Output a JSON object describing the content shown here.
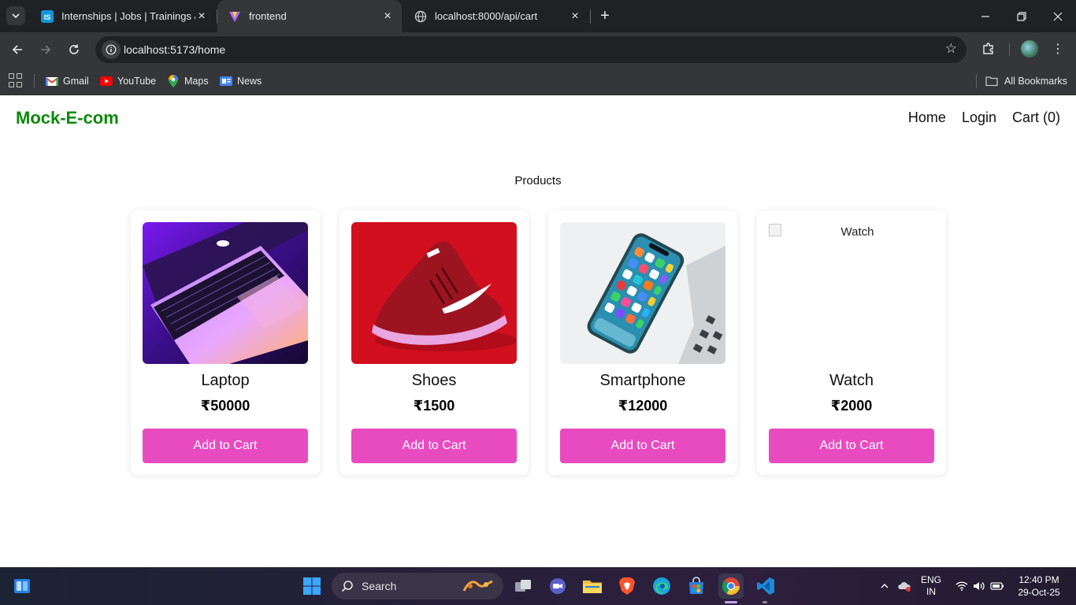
{
  "browser": {
    "tabs": [
      {
        "title": "Internships | Jobs | Trainings & I",
        "favicon": "internshala-icon",
        "active": false
      },
      {
        "title": "frontend",
        "favicon": "vite-icon",
        "active": true
      },
      {
        "title": "localhost:8000/api/cart",
        "favicon": "globe-icon",
        "active": false
      }
    ],
    "url": "localhost:5173/home",
    "bookmarks": [
      {
        "label": "Gmail",
        "icon": "gmail-icon"
      },
      {
        "label": "YouTube",
        "icon": "youtube-icon"
      },
      {
        "label": "Maps",
        "icon": "maps-icon"
      },
      {
        "label": "News",
        "icon": "news-icon"
      }
    ],
    "all_bookmarks": "All Bookmarks",
    "tab_search_badge": "IS"
  },
  "site": {
    "brand": "Mock-E-com",
    "brand_color": "#0a8a0a",
    "nav": {
      "home": "Home",
      "login": "Login",
      "cart": "Cart (0)"
    },
    "heading": "Products",
    "button_color": "#e84bc0",
    "products": [
      {
        "name": "Laptop",
        "price": "₹50000",
        "button": "Add to Cart",
        "image": "laptop-image"
      },
      {
        "name": "Shoes",
        "price": "₹1500",
        "button": "Add to Cart",
        "image": "shoes-image"
      },
      {
        "name": "Smartphone",
        "price": "₹12000",
        "button": "Add to Cart",
        "image": "smartphone-image"
      },
      {
        "name": "Watch",
        "price": "₹2000",
        "button": "Add to Cart",
        "image": "broken-image",
        "alt": "Watch"
      }
    ]
  },
  "taskbar": {
    "search_label": "Search",
    "lang_top": "ENG",
    "lang_bottom": "IN",
    "time": "12:40 PM",
    "date": "29-Oct-25"
  }
}
